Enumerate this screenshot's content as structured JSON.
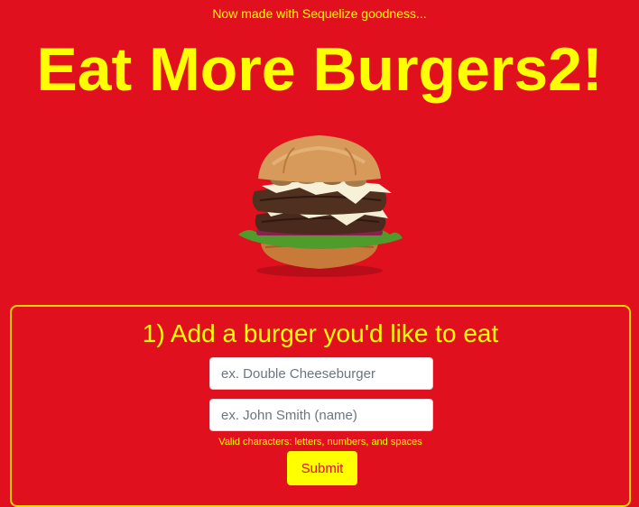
{
  "header": {
    "tagline": "Now made with Sequelize goodness...",
    "title": "Eat More Burgers2!"
  },
  "hero": {
    "image_name": "burger-image"
  },
  "form": {
    "title": "1) Add a burger you'd like to eat",
    "burger_placeholder": "ex. Double Cheeseburger",
    "name_placeholder": "ex. John Smith (name)",
    "hint": "Valid characters: letters, numbers, and spaces",
    "submit_label": "Submit"
  },
  "colors": {
    "background": "#e0101f",
    "accent": "#ffff00",
    "border": "#f5d400"
  }
}
